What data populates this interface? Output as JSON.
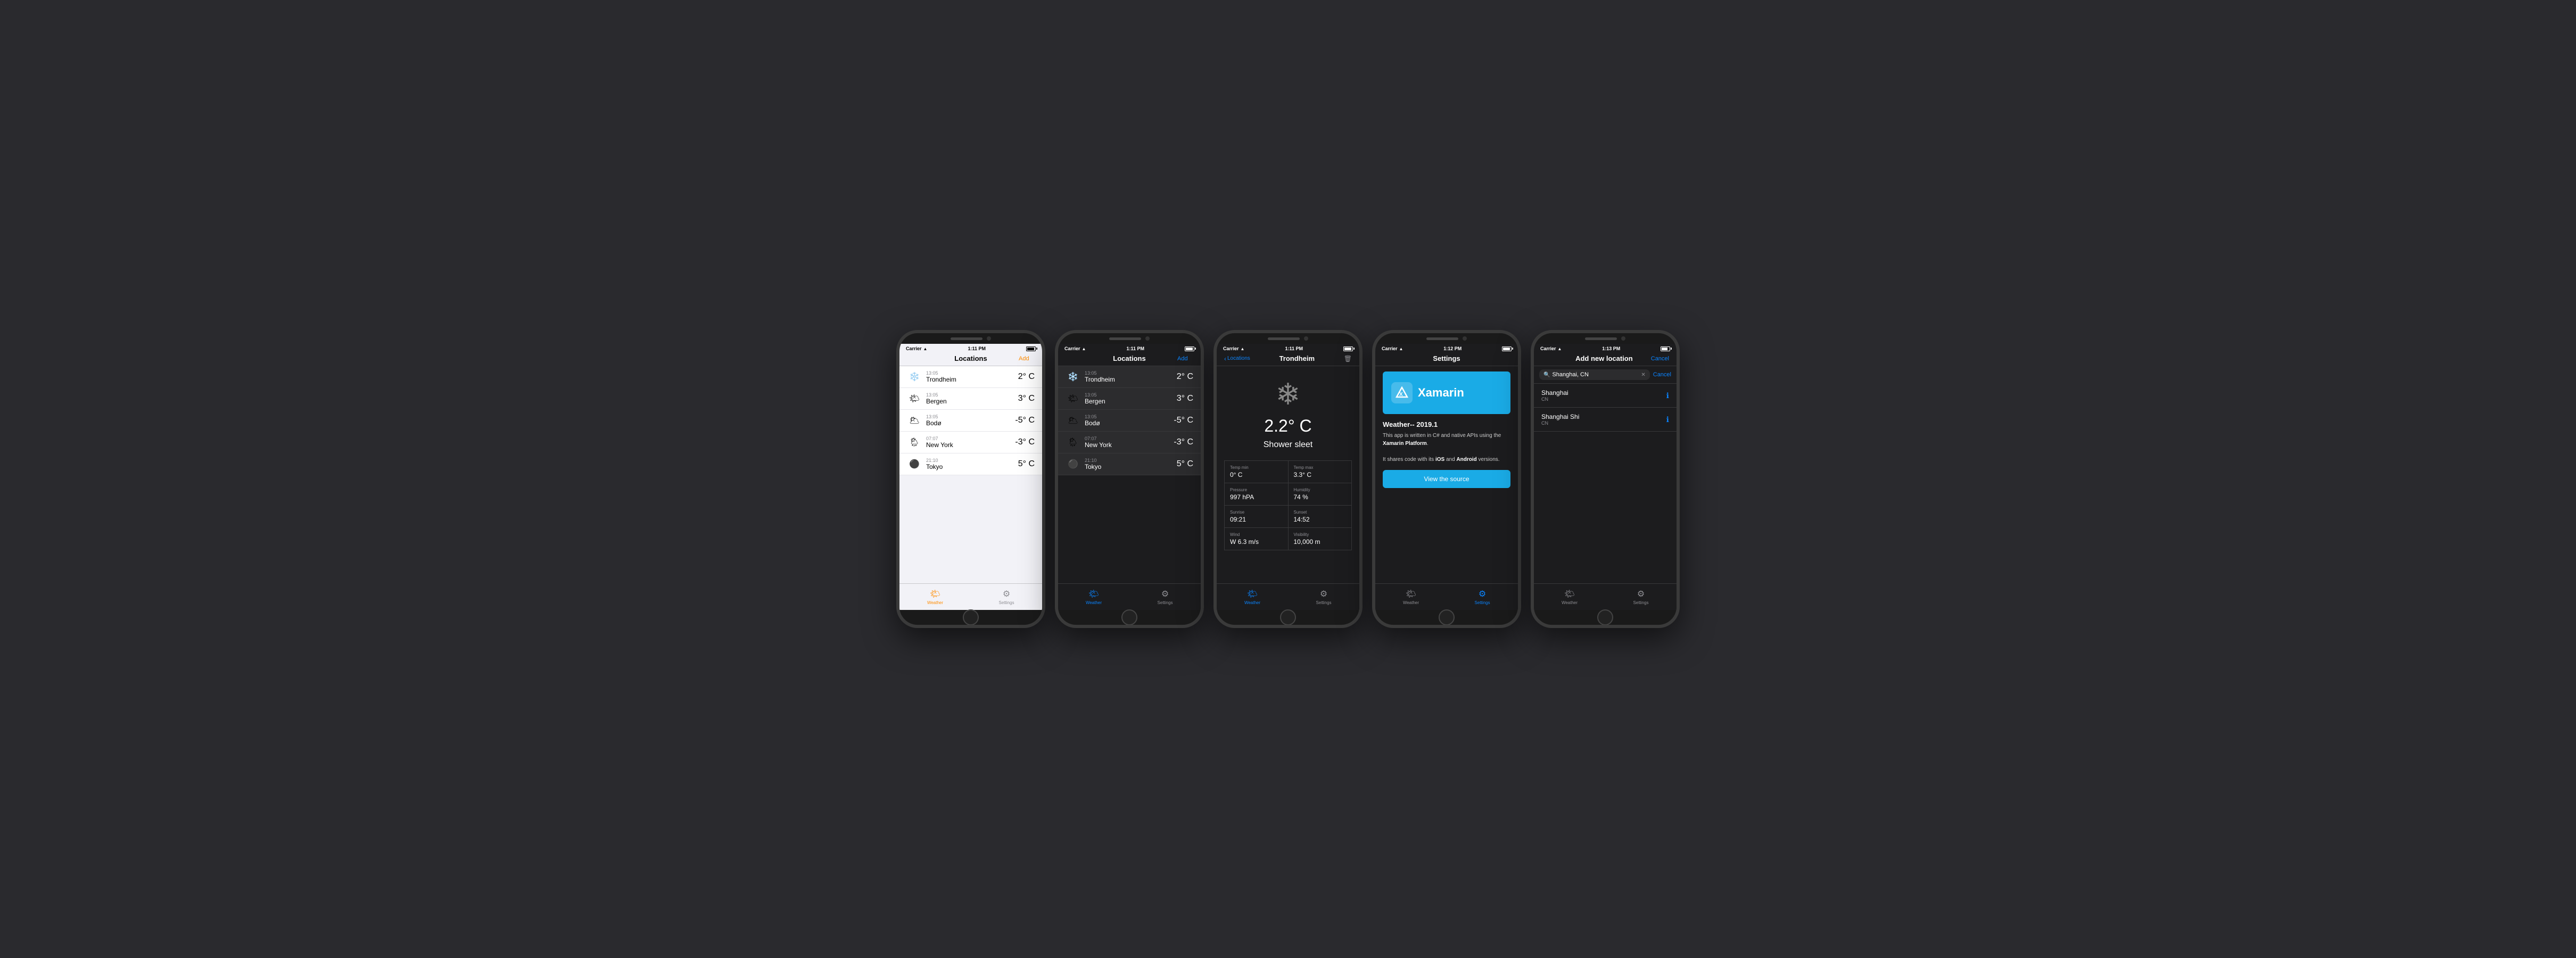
{
  "phones": [
    {
      "id": "phone1",
      "theme": "light",
      "statusBar": {
        "carrier": "Carrier",
        "wifi": true,
        "time": "1:11 PM",
        "battery": 90
      },
      "nav": {
        "title": "Locations",
        "rightBtn": "Add",
        "rightBtnColor": "orange"
      },
      "locations": [
        {
          "icon": "❄️",
          "time": "13:05",
          "name": "Trondheim",
          "temp": "2° C"
        },
        {
          "icon": "🌤",
          "time": "13:05",
          "name": "Bergen",
          "temp": "3° C"
        },
        {
          "icon": "🌥",
          "time": "13:05",
          "name": "Bodø",
          "temp": "-5° C"
        },
        {
          "icon": "🌦",
          "time": "07:07",
          "name": "New York",
          "temp": "-3° C"
        },
        {
          "icon": "⚫",
          "time": "21:10",
          "name": "Tokyo",
          "temp": "5° C"
        }
      ],
      "tabs": [
        {
          "icon": "🌤",
          "label": "Weather",
          "active": true,
          "activeColor": "orange"
        },
        {
          "icon": "⚙",
          "label": "Settings",
          "active": false
        }
      ]
    },
    {
      "id": "phone2",
      "theme": "dark",
      "statusBar": {
        "carrier": "Carrier",
        "wifi": true,
        "time": "1:11 PM",
        "battery": 90
      },
      "nav": {
        "title": "Locations",
        "rightBtn": "Add",
        "rightBtnColor": "blue"
      },
      "locations": [
        {
          "icon": "❄️",
          "time": "13:05",
          "name": "Trondheim",
          "temp": "2° C"
        },
        {
          "icon": "🌤",
          "time": "13:05",
          "name": "Bergen",
          "temp": "3° C"
        },
        {
          "icon": "🌥",
          "time": "13:05",
          "name": "Bodø",
          "temp": "-5° C"
        },
        {
          "icon": "🌦",
          "time": "07:07",
          "name": "New York",
          "temp": "-3° C"
        },
        {
          "icon": "⚫",
          "time": "21:10",
          "name": "Tokyo",
          "temp": "5° C"
        }
      ],
      "tabs": [
        {
          "icon": "🌤",
          "label": "Weather",
          "active": true,
          "activeColor": "blue"
        },
        {
          "icon": "⚙",
          "label": "Settings",
          "active": false
        }
      ]
    },
    {
      "id": "phone3",
      "theme": "detail",
      "statusBar": {
        "carrier": "Carrier",
        "wifi": true,
        "time": "1:11 PM",
        "battery": 90
      },
      "nav": {
        "back": "Locations",
        "title": "Trondheim",
        "rightIcon": "🗑"
      },
      "detail": {
        "icon": "❄",
        "temp": "2.2° C",
        "condition": "Shower sleet",
        "cells": [
          {
            "label": "Temp min",
            "value": "0° C"
          },
          {
            "label": "Temp max",
            "value": "3.3° C"
          },
          {
            "label": "Pressure",
            "value": "997 hPA"
          },
          {
            "label": "Humidity",
            "value": "74 %"
          },
          {
            "label": "Sunrise",
            "value": "09:21"
          },
          {
            "label": "Sunset",
            "value": "14:52"
          },
          {
            "label": "Wind",
            "value": "W 6.3 m/s"
          },
          {
            "label": "Visibility",
            "value": "10,000 m"
          }
        ]
      },
      "tabs": [
        {
          "icon": "🌤",
          "label": "Weather",
          "active": true,
          "activeColor": "blue"
        },
        {
          "icon": "⚙",
          "label": "Settings",
          "active": false
        }
      ]
    },
    {
      "id": "phone4",
      "theme": "settings",
      "statusBar": {
        "carrier": "Carrier",
        "wifi": true,
        "time": "1:12 PM",
        "battery": 90
      },
      "nav": {
        "title": "Settings"
      },
      "settings": {
        "bannerBg": "#1aabe6",
        "logoText": "X",
        "brandName": "Xamarin",
        "appTitle": "Weather-- 2019.1",
        "description1": "This app is written in C# and native APIs using the ",
        "descriptionLink": "Xamarin Platform",
        "description2": ".",
        "description3": "It shares code with its ",
        "descriptionBold1": "iOS",
        "description4": " and ",
        "descriptionBold2": "Android",
        "description5": " versions.",
        "viewSourceBtn": "View the source"
      },
      "tabs": [
        {
          "icon": "🌤",
          "label": "Weather",
          "active": false
        },
        {
          "icon": "⚙",
          "label": "Settings",
          "active": true,
          "activeColor": "blue"
        }
      ]
    },
    {
      "id": "phone5",
      "theme": "add",
      "statusBar": {
        "carrier": "Carrier",
        "wifi": true,
        "time": "1:13 PM",
        "battery": 80
      },
      "nav": {
        "title": "Add new location",
        "rightBtn": "Cancel",
        "rightBtnColor": "blue"
      },
      "search": {
        "placeholder": "Shanghai, CN",
        "value": "Shanghai, CN"
      },
      "results": [
        {
          "name": "Shanghai",
          "sub": "CN"
        },
        {
          "name": "Shanghai Shi",
          "sub": "CN"
        }
      ],
      "tabs": [
        {
          "icon": "🌤",
          "label": "Weather",
          "active": false
        },
        {
          "icon": "⚙",
          "label": "Settings",
          "active": false
        }
      ]
    }
  ],
  "labels": {
    "weather": "Weather",
    "settings": "Settings",
    "locations": "Locations",
    "add": "Add",
    "cancel": "Cancel",
    "viewSource": "View the source"
  }
}
